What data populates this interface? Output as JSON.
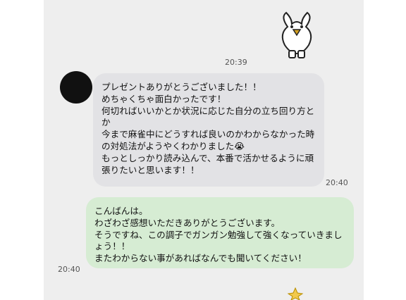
{
  "messages": [
    {
      "time": "20:39"
    },
    {
      "text": "プレゼントありがとうございました！！\nめちゃくちゃ面白かったです！\n何切ればいいかとか状況に応じた自分の立ち回り方とか\n今まで麻雀中にどうすれば良いのかわからなかった時の対処法がようやくわかりました😭\nもっとしっかり読み込んで、本番で活かせるように頑張りたいと思います！！",
      "time": "20:40"
    },
    {
      "text": "こんばんは。\nわざわざ感想いただきありがとうございます。\nそうですね、この調子でガンガン勉強して強くなっていきましょう！！\nまたわからない事があればなんでも聞いてください！",
      "time": "20:40"
    }
  ],
  "icons": {
    "sticker_top": "chick-sticker-icon",
    "avatar": "avatar-icon",
    "sticker_bottom": "star-sticker-icon"
  }
}
